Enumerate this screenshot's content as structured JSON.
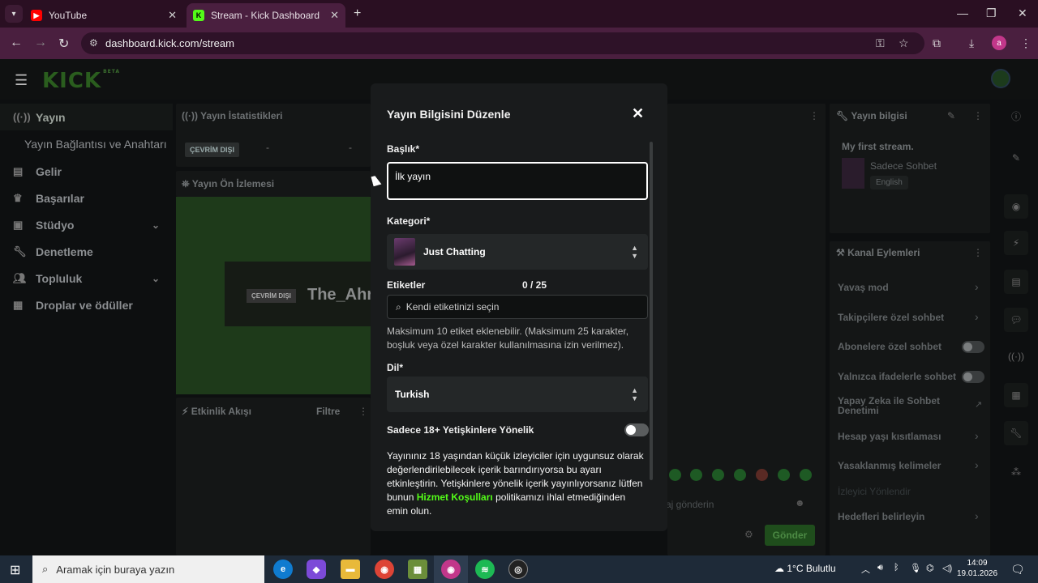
{
  "browser": {
    "tabs": [
      {
        "title": "YouTube",
        "icon": "youtube-icon"
      },
      {
        "title": "Stream - Kick Dashboard",
        "icon": "kick-icon"
      }
    ],
    "url": "dashboard.kick.com/stream",
    "profile_initial": "a"
  },
  "kick": {
    "logo": "KICK",
    "logo_badge": "BETA",
    "sidebar": {
      "items": [
        {
          "label": "Yayın",
          "icon": "broadcast-icon"
        },
        {
          "label": "Yayın Bağlantısı ve Anahtarı"
        },
        {
          "label": "Gelir",
          "icon": "chart-icon"
        },
        {
          "label": "Başarılar",
          "icon": "trophy-icon"
        },
        {
          "label": "Stüdyo",
          "icon": "studio-icon"
        },
        {
          "label": "Denetleme",
          "icon": "wrench-icon"
        },
        {
          "label": "Topluluk",
          "icon": "people-icon"
        },
        {
          "label": "Droplar ve ödüller",
          "icon": "gift-icon"
        }
      ]
    },
    "stats_panel": {
      "title": "Yayın İstatistikleri",
      "status": "ÇEVRİM DIŞI",
      "dash1": "-",
      "dash2": "-"
    },
    "preview_panel": {
      "title": "Yayın Ön İzlemesi",
      "status": "ÇEVRİM DIŞI",
      "channel": "The_Ahr"
    },
    "activity_panel": {
      "title": "Etkinlik Akışı",
      "filter": "Filtre"
    },
    "stream_info": {
      "title": "Yayın bilgisi",
      "stream_title": "My first stream.",
      "category": "Sadece Sohbet",
      "language": "English"
    },
    "channel_actions": {
      "title": "Kanal Eylemleri",
      "items": [
        "Yavaş mod",
        "Takipçilere özel sohbet",
        "Abonelere özel sohbet",
        "Yalnızca ifadelerle sohbet",
        "Yapay Zeka ile Sohbet Denetimi",
        "Hesap yaşı kısıtlaması",
        "Yasaklanmış kelimeler",
        "İzleyici Yönlendir",
        "Hedefleri belirleyin"
      ]
    },
    "chat": {
      "placeholder": "aj gönderin",
      "send": "Gönder"
    }
  },
  "modal": {
    "title": "Yayın Bilgisini Düzenle",
    "title_label": "Başlık*",
    "title_value": "İlk yayın",
    "category_label": "Kategori*",
    "category_value": "Just Chatting",
    "tags_label": "Etiketler",
    "tags_count": "0 / 25",
    "tags_placeholder": "Kendi etiketinizi seçin",
    "tags_help": "Maksimum 10 etiket eklenebilir. (Maksimum 25 karakter, boşluk veya özel karakter kullanılmasına izin verilmez).",
    "language_label": "Dil*",
    "language_value": "Turkish",
    "adult_label": "Sadece 18+ Yetişkinlere Yönelik",
    "adult_enabled": false,
    "adult_text_1": "Yayınınız 18 yaşından küçük izleyiciler için uygunsuz olarak değerlendirilebilecek içerik barındırıyorsa bu ayarı etkinleştirin. Yetişkinlere yönelik içerik yayınlıyorsanız lütfen bunun ",
    "adult_link": "Hizmet Koşulları",
    "adult_text_2": " politikamızı ihlal etmediğinden emin olun."
  },
  "taskbar": {
    "search_placeholder": "Aramak için buraya yazın",
    "weather": "1°C  Bulutlu",
    "time": "14:09",
    "date": "19.01.2026"
  },
  "colors": {
    "accent": "#53fc18",
    "tabbar": "#2a0f22",
    "addressbar": "#4a1f3f"
  }
}
